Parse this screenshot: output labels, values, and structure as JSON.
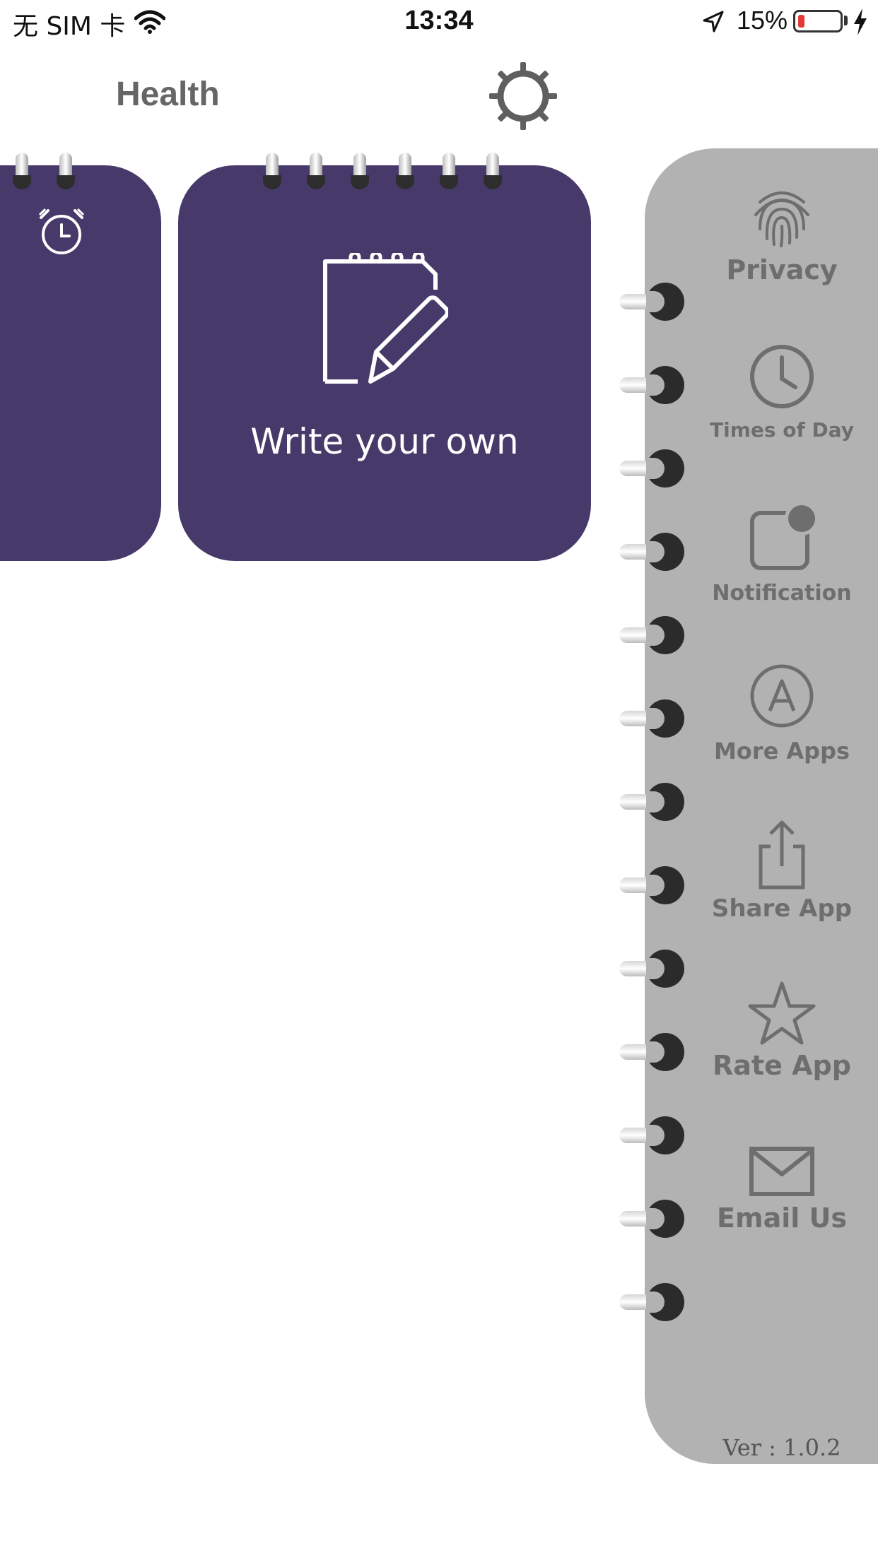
{
  "status_bar": {
    "carrier": "无 SIM 卡",
    "time": "13:34",
    "battery_percent": "15%",
    "battery_level": 0.15,
    "icons": [
      "wifi-icon",
      "location-arrow-icon",
      "battery-icon",
      "charging-bolt-icon"
    ]
  },
  "header": {
    "title": "Health",
    "settings_icon": "gear-icon"
  },
  "cards": [
    {
      "id": "partial-card",
      "icon": "alarm-clock-icon",
      "label": ""
    },
    {
      "id": "write-own-card",
      "icon": "notepad-pencil-icon",
      "label": "Write your own"
    }
  ],
  "sidebar": {
    "items": [
      {
        "label": "Privacy",
        "icon": "fingerprint-icon"
      },
      {
        "label": "Times of Day",
        "icon": "clock-icon"
      },
      {
        "label": "Notification",
        "icon": "notification-badge-icon"
      },
      {
        "label": "More Apps",
        "icon": "app-store-icon"
      },
      {
        "label": "Share App",
        "icon": "share-icon"
      },
      {
        "label": "Rate App",
        "icon": "star-icon"
      },
      {
        "label": "Email Us",
        "icon": "envelope-icon"
      }
    ],
    "version": "Ver : 1.0.2"
  },
  "colors": {
    "card_purple": "#473969",
    "sidebar_gray": "#b2b2b2",
    "icon_gray": "#6e6e6e",
    "header_gray": "#666666"
  }
}
